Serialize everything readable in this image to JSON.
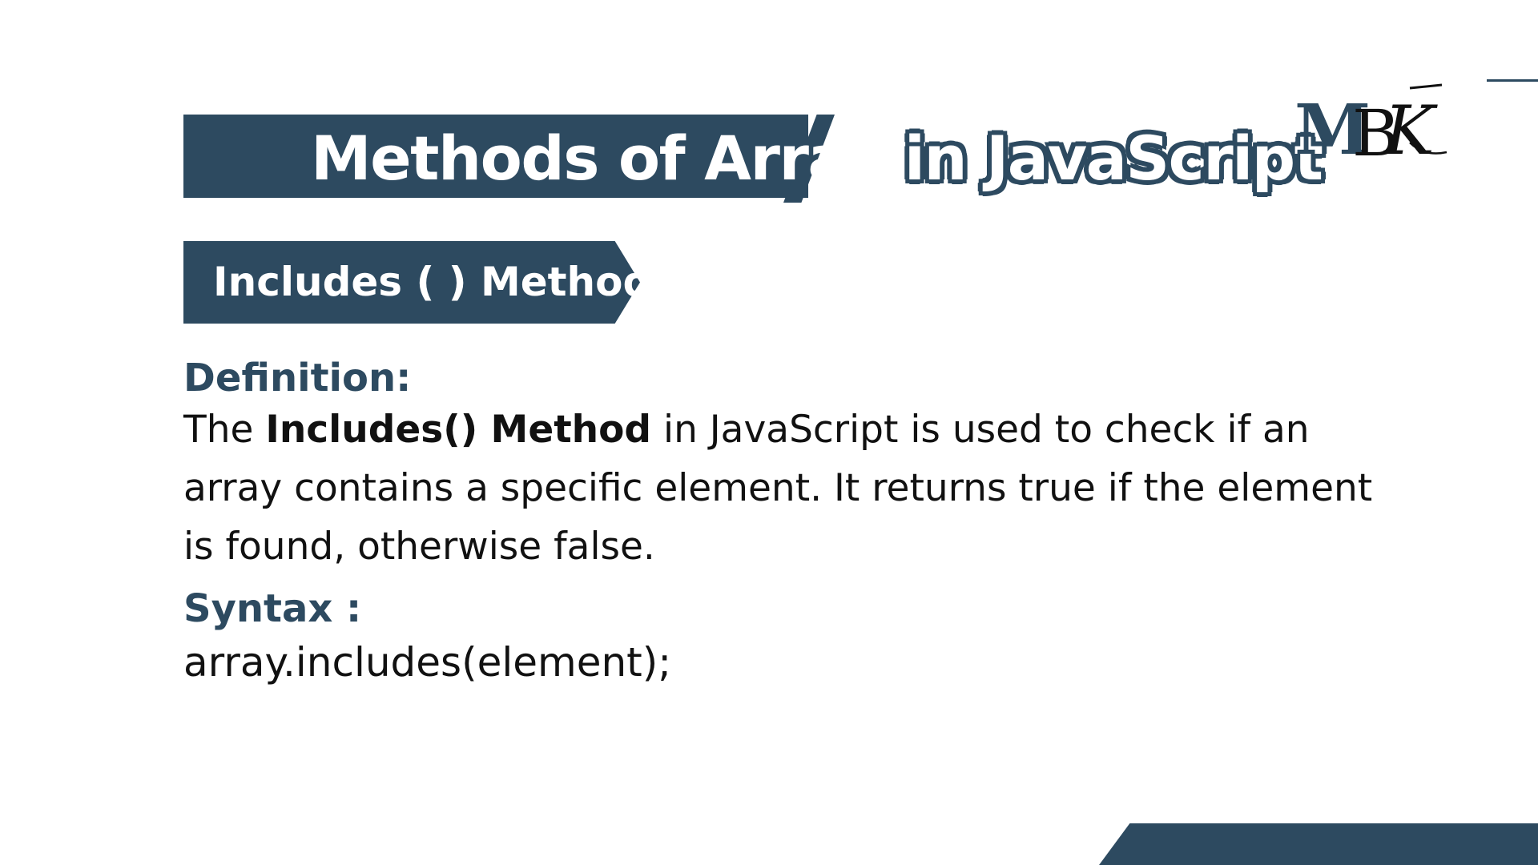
{
  "title": {
    "part1": "Methods of Array",
    "part2": "in JavaScript"
  },
  "logo": {
    "text": "MBK"
  },
  "method": {
    "heading": "Includes ( ) Method"
  },
  "definition": {
    "label": "Definition:",
    "lead": "The ",
    "term": "Includes() Method",
    "line1_rest": " in JavaScript is used to check if an",
    "line2": "array contains a specific element. It returns true if the element",
    "line3": "is found, otherwise false."
  },
  "syntax": {
    "label": "Syntax :",
    "code": "array.includes(element);"
  },
  "colors": {
    "accent": "#2d4a60",
    "text": "#111111",
    "background": "#ffffff"
  }
}
